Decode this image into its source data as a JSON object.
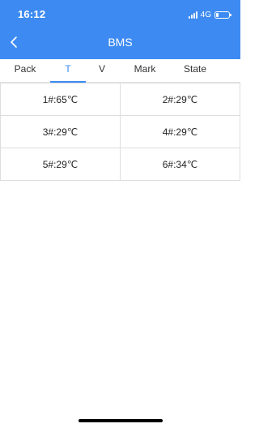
{
  "status_bar": {
    "time": "16:12",
    "network": "4G",
    "signal_bars": 4,
    "battery_level": 0.2
  },
  "nav": {
    "title": "BMS",
    "back_icon": "chevron-left-icon"
  },
  "tabs": [
    {
      "label": "Pack",
      "active": false
    },
    {
      "label": "T",
      "active": true
    },
    {
      "label": "V",
      "active": false
    },
    {
      "label": "Mark",
      "active": false
    },
    {
      "label": "State",
      "active": false
    }
  ],
  "temperatures": [
    {
      "label": "1#:65℃"
    },
    {
      "label": "2#:29℃"
    },
    {
      "label": "3#:29℃"
    },
    {
      "label": "4#:29℃"
    },
    {
      "label": "5#:29℃"
    },
    {
      "label": "6#:34℃"
    }
  ],
  "colors": {
    "accent": "#3d8bf2",
    "text": "#222222",
    "divider": "#dddddd"
  }
}
